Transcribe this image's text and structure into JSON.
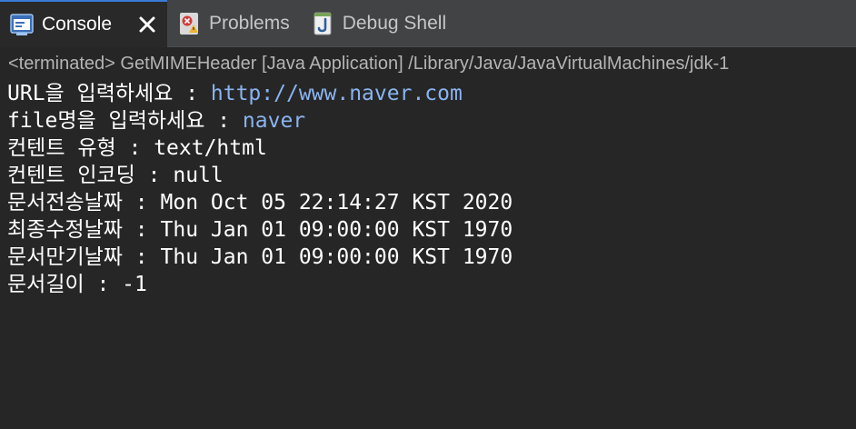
{
  "tabs": [
    {
      "label": "Console",
      "active": true,
      "icon": "console-icon"
    },
    {
      "label": "Problems",
      "active": false,
      "icon": "problems-icon"
    },
    {
      "label": "Debug Shell",
      "active": false,
      "icon": "debug-shell-icon"
    }
  ],
  "status": "<terminated> GetMIMEHeader [Java Application] /Library/Java/JavaVirtualMachines/jdk-1",
  "output": {
    "lines": [
      {
        "prompt": "URL을 입력하세요 : ",
        "input": "http://www.naver.com"
      },
      {
        "prompt": "file명을 입력하세요 : ",
        "input": "naver"
      },
      {
        "text": "컨텐트 유형 : text/html"
      },
      {
        "text": "컨텐트 인코딩 : null"
      },
      {
        "text": "문서전송날짜 : Mon Oct 05 22:14:27 KST 2020"
      },
      {
        "text": "최종수정날짜 : Thu Jan 01 09:00:00 KST 1970"
      },
      {
        "text": "문서만기날짜 : Thu Jan 01 09:00:00 KST 1970"
      },
      {
        "text": "문서길이 : -1"
      }
    ]
  },
  "colors": {
    "background": "#262626",
    "tab_bar": "#414345",
    "active_tab": "#292929",
    "user_input": "#8ab4f0",
    "output_text": "#ffffff"
  }
}
